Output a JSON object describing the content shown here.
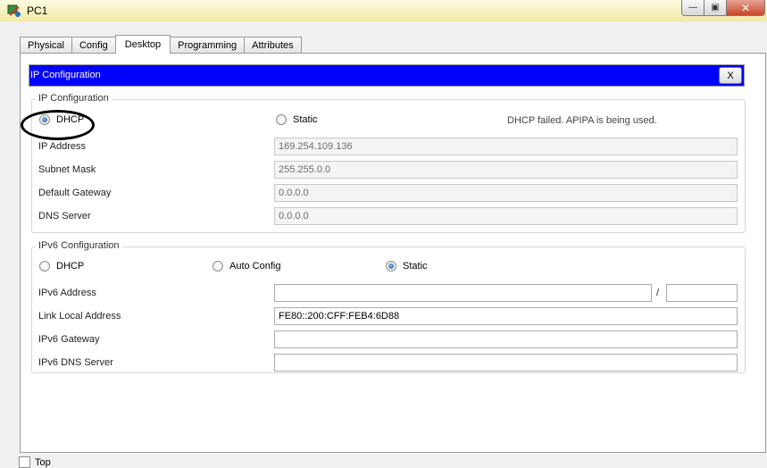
{
  "window": {
    "title": "PC1",
    "restore_glyph": "▣",
    "min_glyph": "—",
    "close_glyph": "✕"
  },
  "tabs": [
    {
      "label": "Physical",
      "active": false
    },
    {
      "label": "Config",
      "active": false
    },
    {
      "label": "Desktop",
      "active": true
    },
    {
      "label": "Programming",
      "active": false
    },
    {
      "label": "Attributes",
      "active": false
    }
  ],
  "ip_config": {
    "header_title": "IP Configuration",
    "close_label": "X",
    "group_title": "IP Configuration",
    "dhcp_label": "DHCP",
    "static_label": "Static",
    "selected": "DHCP",
    "status": "DHCP failed. APIPA is being used.",
    "ip_address_label": "IP Address",
    "ip_address": "169.254.109.136",
    "subnet_mask_label": "Subnet Mask",
    "subnet_mask": "255.255.0.0",
    "default_gateway_label": "Default Gateway",
    "default_gateway": "0.0.0.0",
    "dns_server_label": "DNS Server",
    "dns_server": "0.0.0.0"
  },
  "ipv6_config": {
    "group_title": "IPv6 Configuration",
    "dhcp_label": "DHCP",
    "auto_label": "Auto Config",
    "static_label": "Static",
    "selected": "Static",
    "ipv6_address_label": "IPv6 Address",
    "ipv6_address": "",
    "prefix_separator": "/",
    "prefix_length": "",
    "link_local_label": "Link Local Address",
    "link_local": "FE80::200:CFF:FEB4:6D88",
    "ipv6_gateway_label": "IPv6 Gateway",
    "ipv6_gateway": "",
    "ipv6_dns_label": "IPv6 DNS Server",
    "ipv6_dns": ""
  },
  "footer": {
    "top_label": "Top"
  },
  "colors": {
    "header_bg": "#0000ff",
    "annotation": "#000000"
  }
}
